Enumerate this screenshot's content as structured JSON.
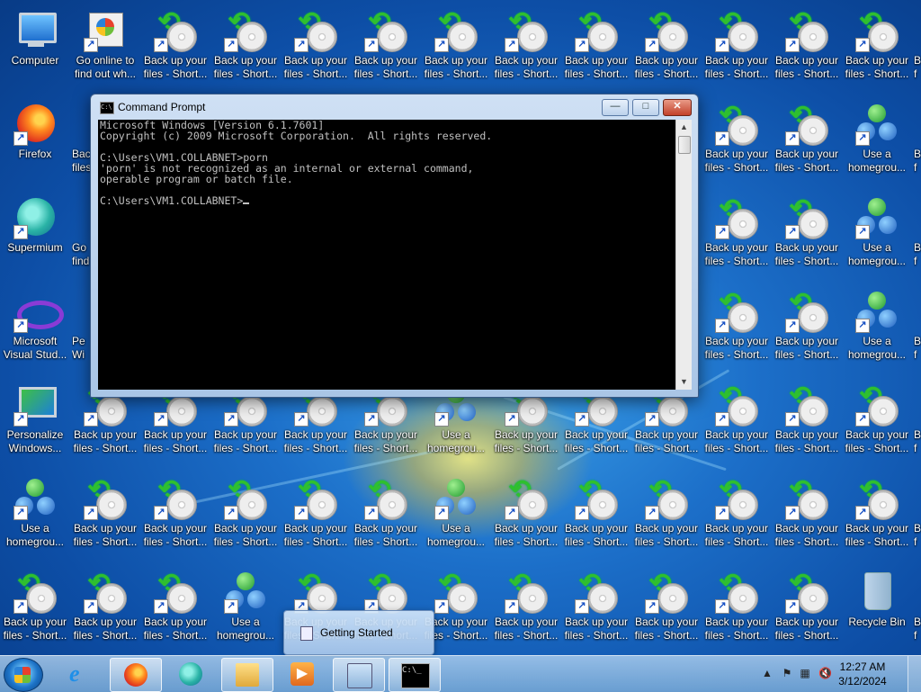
{
  "desktop_icons": {
    "computer": "Computer",
    "go_online": [
      "Go online to",
      "find out wh..."
    ],
    "firefox": "Firefox",
    "supermium": "Supermium",
    "visual_studio": [
      "Microsoft",
      "Visual Stud..."
    ],
    "personalize": [
      "Personalize",
      "Windows..."
    ],
    "backup": [
      "Back up your",
      "files - Short..."
    ],
    "homegroup": [
      "Use a",
      "homegrou..."
    ],
    "recycle_bin": "Recycle Bin",
    "partial_back": "Bac",
    "partial_files": "files",
    "partial_go": "Go",
    "partial_find": "find",
    "partial_pe": "Pe",
    "partial_wi": "Wi",
    "partial_b": "B",
    "partial_f": "f"
  },
  "cmd": {
    "title": "Command Prompt",
    "lines": [
      "Microsoft Windows [Version 6.1.7601]",
      "Copyright (c) 2009 Microsoft Corporation.  All rights reserved.",
      "",
      "C:\\Users\\VM1.COLLABNET>porn",
      "'porn' is not recognized as an internal or external command,",
      "operable program or batch file.",
      "",
      "C:\\Users\\VM1.COLLABNET>"
    ],
    "minimize": "—",
    "maximize": "□",
    "close": "✕"
  },
  "popup": {
    "label": "Getting Started"
  },
  "taskbar": {
    "items": [
      "internet-explorer",
      "firefox",
      "supermium",
      "explorer",
      "media-player",
      "getting-started",
      "command-prompt"
    ],
    "clock_time": "12:27 AM",
    "clock_date": "3/12/2024",
    "tray_icons": [
      "show-hidden-icons",
      "action-center-flag",
      "network-icon",
      "volume-muted-icon"
    ]
  },
  "colors": {
    "desktop": "#1c6fc9",
    "console_bg": "#000000",
    "console_text": "#c0c0c0"
  }
}
